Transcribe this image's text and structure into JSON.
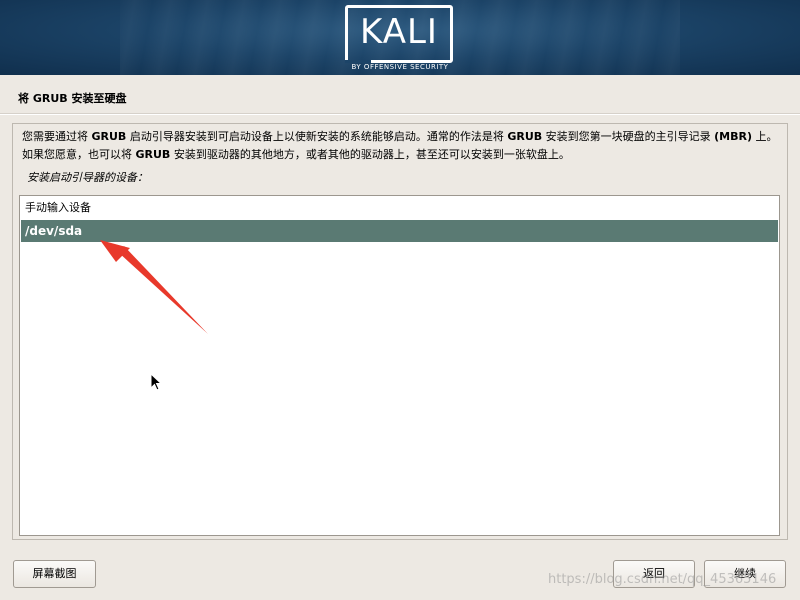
{
  "banner": {
    "logo_text": "KALI",
    "logo_subtitle": "BY OFFENSIVE SECURITY"
  },
  "page": {
    "title": "将 GRUB 安装至硬盘",
    "description": {
      "p1": "您需要通过将 ",
      "grub1": "GRUB",
      "p2": " 启动引导器安装到可启动设备上以使新安装的系统能够启动。通常的作法是将 ",
      "grub2": "GRUB",
      "p3": " 安装到您第一块硬盘的主引导记录 ",
      "mbr": "(MBR)",
      "p4": " 上。如果您愿意，也可以将 ",
      "grub3": "GRUB",
      "p5": " 安装到驱动器的其他地方，或者其他的驱动器上，甚至还可以安装到一张软盘上。"
    },
    "prompt": "安装启动引导器的设备："
  },
  "device_list": {
    "items": [
      {
        "label": "手动输入设备",
        "selected": false
      },
      {
        "label": "/dev/sda",
        "selected": true
      }
    ]
  },
  "buttons": {
    "screenshot": "屏幕截图",
    "back": "返回",
    "continue": "继续"
  },
  "watermark": "https://blog.csdn.net/qq_45365146",
  "colors": {
    "selection": "#5a7a73",
    "annotation_arrow": "#e8392b",
    "banner": "#1c4468"
  },
  "icons": {
    "annotation": "red-arrow-icon",
    "pointer": "mouse-cursor-icon"
  }
}
